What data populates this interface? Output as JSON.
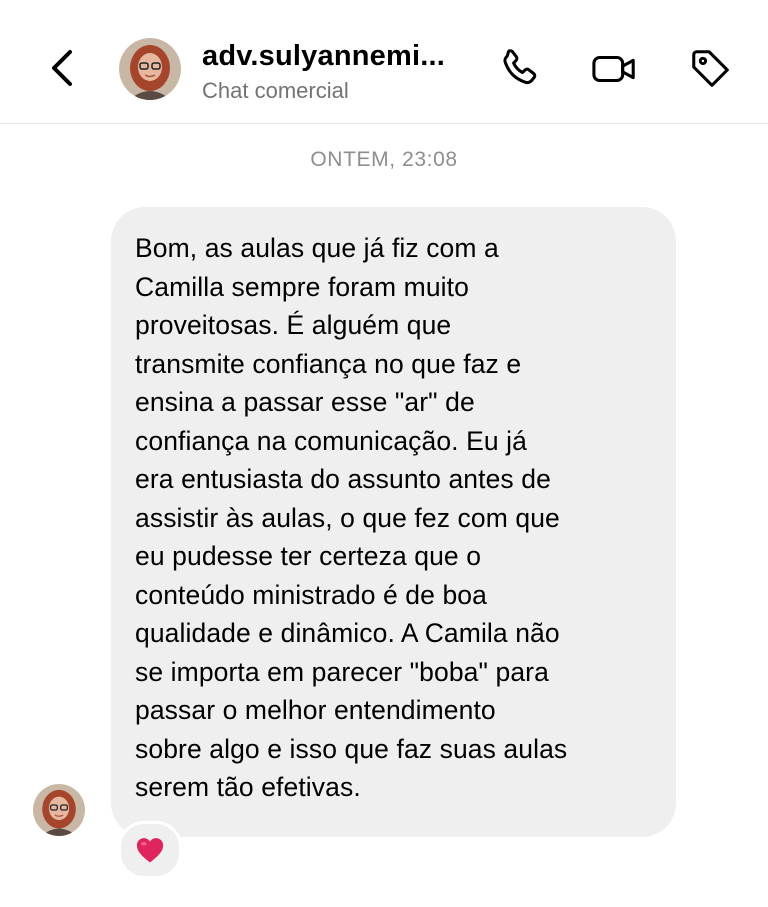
{
  "header": {
    "chat_name": "adv.sulyannemi...",
    "subtitle": "Chat comercial",
    "back_icon": "chevron-left-icon",
    "actions": [
      {
        "name": "phone-call-icon"
      },
      {
        "name": "video-call-icon"
      },
      {
        "name": "tag-icon"
      }
    ]
  },
  "conversation": {
    "timestamp": "ONTEM, 23:08",
    "messages": [
      {
        "sender": "adv.sulyannemi...",
        "text": "Bom, as aulas que já fiz com a\nCamilla sempre foram muito\nproveitosas. É alguém que\ntransmite confiança no que faz e\nensina a passar esse \"ar\" de\nconfiança na comunicação. Eu já\nera entusiasta do assunto antes de\nassistir às aulas, o que fez com que\neu pudesse ter certeza que o\nconteúdo ministrado é de boa\nqualidade e dinâmico. A Camila não\nse importa em parecer \"boba\" para\npassar o melhor entendimento\nsobre algo e isso que faz suas aulas\nserem tão efetivas.",
        "reaction": "❤️"
      }
    ]
  },
  "colors": {
    "bubble_bg": "#efefef",
    "muted_text": "#737373",
    "timestamp_text": "#8e8e8e",
    "heart": "#e0245e"
  }
}
